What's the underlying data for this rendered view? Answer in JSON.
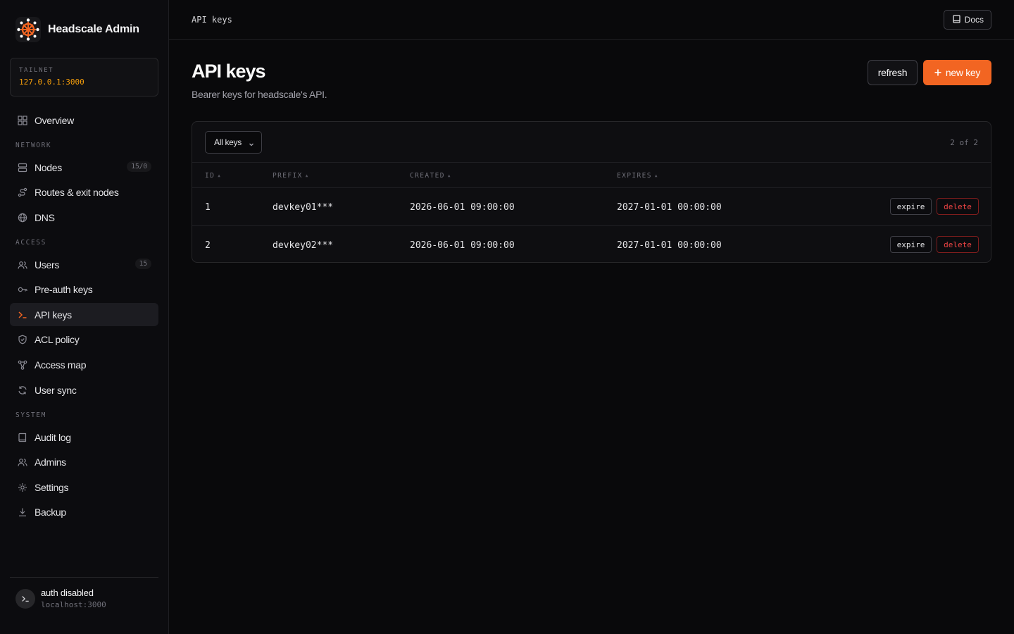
{
  "app": {
    "title": "Headscale Admin",
    "accent": "#f26522"
  },
  "tailnet": {
    "label": "TAILNET",
    "value": "127.0.0.1:3000"
  },
  "nav": {
    "overview": {
      "label": "Overview",
      "icon": "grid-icon"
    },
    "sections": {
      "network": "NETWORK",
      "access": "ACCESS",
      "system": "SYSTEM"
    },
    "nodes": {
      "label": "Nodes",
      "badge": "15/0",
      "icon": "server-icon"
    },
    "routes": {
      "label": "Routes & exit nodes",
      "icon": "route-icon"
    },
    "dns": {
      "label": "DNS",
      "icon": "globe-icon"
    },
    "users": {
      "label": "Users",
      "badge": "15",
      "icon": "users-icon"
    },
    "preauth": {
      "label": "Pre-auth keys",
      "icon": "key-icon"
    },
    "apikeys": {
      "label": "API keys",
      "icon": "terminal-icon",
      "active": true
    },
    "acl": {
      "label": "ACL policy",
      "icon": "shield-icon"
    },
    "accessmap": {
      "label": "Access map",
      "icon": "network-icon"
    },
    "usersync": {
      "label": "User sync",
      "icon": "refresh-icon"
    },
    "audit": {
      "label": "Audit log",
      "icon": "book-icon"
    },
    "admins": {
      "label": "Admins",
      "icon": "users-icon"
    },
    "settings": {
      "label": "Settings",
      "icon": "gear-icon"
    },
    "backup": {
      "label": "Backup",
      "icon": "download-icon"
    }
  },
  "footer": {
    "title": "auth disabled",
    "subtitle": "localhost:3000"
  },
  "topbar": {
    "breadcrumb": "API keys",
    "docs_label": "Docs"
  },
  "page": {
    "title": "API keys",
    "subtitle": "Bearer keys for headscale's API.",
    "refresh_label": "refresh",
    "new_label": "new key"
  },
  "table": {
    "filter": "All keys",
    "count": "2 of 2",
    "columns": [
      "ID",
      "PREFIX",
      "CREATED",
      "EXPIRES"
    ],
    "rows": [
      {
        "id": "1",
        "prefix": "devkey01***",
        "created": "2026-06-01 09:00:00",
        "expires": "2027-01-01 00:00:00",
        "expire_label": "expire",
        "delete_label": "delete"
      },
      {
        "id": "2",
        "prefix": "devkey02***",
        "created": "2026-06-01 09:00:00",
        "expires": "2027-01-01 00:00:00",
        "expire_label": "expire",
        "delete_label": "delete"
      }
    ]
  }
}
